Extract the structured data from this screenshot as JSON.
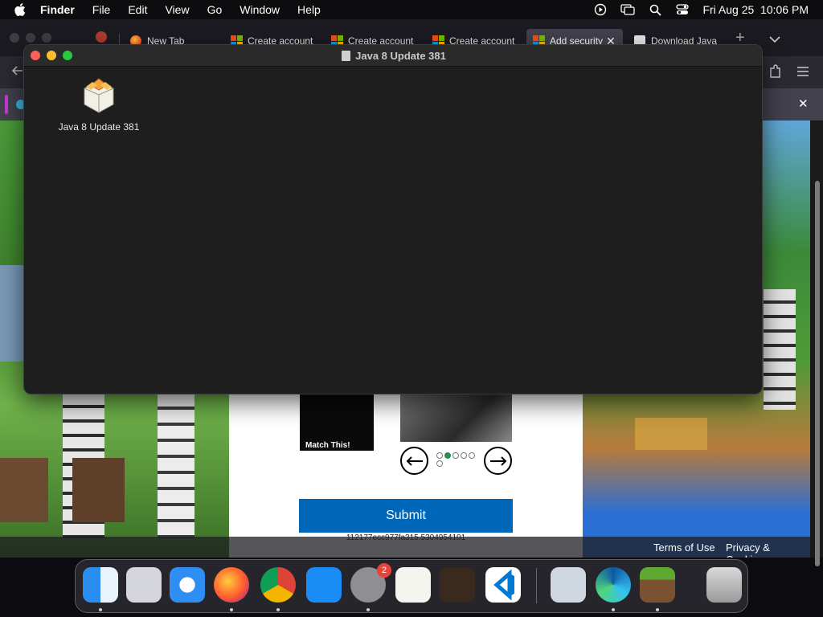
{
  "menubar": {
    "app_name": "Finder",
    "items": [
      "File",
      "Edit",
      "View",
      "Go",
      "Window",
      "Help"
    ],
    "datetime": "Fri Aug 25  10:06 PM"
  },
  "browser": {
    "tabs": [
      {
        "label": "New Tab",
        "favicon": "firefox-icon"
      },
      {
        "label": "Create account",
        "favicon": "microsoft-icon"
      },
      {
        "label": "Create account",
        "favicon": "microsoft-icon"
      },
      {
        "label": "Create account",
        "favicon": "microsoft-icon"
      },
      {
        "label": "Add security",
        "favicon": "microsoft-icon",
        "active": true
      },
      {
        "label": "Download Java",
        "favicon": "java-icon"
      }
    ],
    "page": {
      "match_label": "Match This!",
      "submit_label": "Submit",
      "token": "112177ecc977fa315.5304954101",
      "footer_terms": "Terms of Use",
      "footer_privacy": "Privacy & Cookies",
      "selected_dot": 2,
      "dot_count": 6
    }
  },
  "finder_window": {
    "title": "Java 8 Update 381",
    "items": [
      {
        "label": "Java 8 Update 381",
        "icon": "package-installer-icon"
      }
    ]
  },
  "dock": {
    "apps": [
      "finder",
      "launchpad",
      "safari",
      "firefox",
      "chrome",
      "app-store",
      "system-settings",
      "textedit",
      "garageband",
      "vscode",
      "preview",
      "edge",
      "minecraft",
      "trash"
    ],
    "system_settings_badge": "2"
  },
  "colors": {
    "accent_blue": "#0067b8",
    "traffic_red": "#ff5f57",
    "traffic_yellow": "#febc2e",
    "traffic_green": "#28c840"
  }
}
